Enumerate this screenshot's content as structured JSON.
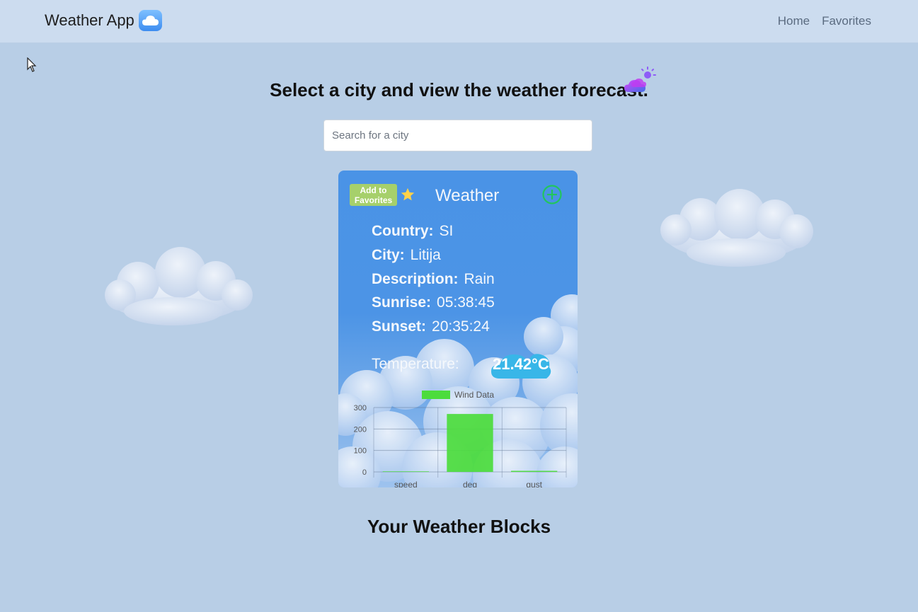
{
  "navbar": {
    "brand": "Weather App",
    "links": [
      "Home",
      "Favorites"
    ]
  },
  "main": {
    "headline": "Select a city and view the weather forecast.",
    "search_placeholder": "Search for a city",
    "blocks_title": "Your Weather Blocks"
  },
  "card": {
    "fav_button": "Add to Favorites",
    "title": "Weather",
    "fields": [
      {
        "label": "Country:",
        "value": "SI"
      },
      {
        "label": "City:",
        "value": "Litija"
      },
      {
        "label": "Description:",
        "value": "Rain"
      },
      {
        "label": "Sunrise:",
        "value": "05:38:45"
      },
      {
        "label": "Sunset:",
        "value": "20:35:24"
      }
    ],
    "temperature_label": "Temperature:",
    "temperature_value": "21.42°C"
  },
  "chart_data": {
    "type": "bar",
    "categories": [
      "speed",
      "deg",
      "gust"
    ],
    "series": [
      {
        "name": "Wind Data",
        "values": [
          2.5,
          270,
          5
        ]
      }
    ],
    "ylim": [
      0,
      300
    ],
    "yticks": [
      "0",
      "100",
      "200",
      "300"
    ],
    "legend_position": "top",
    "grid": true,
    "color": "#4cdc3c"
  },
  "colors": {
    "background": "#b8cee6",
    "navbar": "#ccdcef",
    "card": "#4a93e6",
    "fav_button": "#a6d06b",
    "plus_icon": "#22c55e",
    "bar": "#4cdc3c"
  }
}
